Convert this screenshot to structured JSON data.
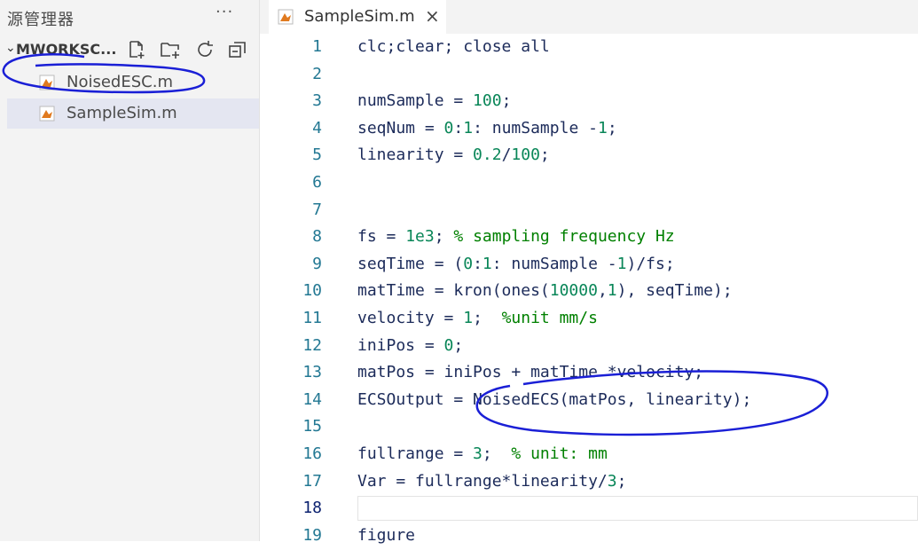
{
  "sidebar": {
    "title": "源管理器",
    "more": "···",
    "workspace": "MWORKSC...",
    "toolbar": [
      "new-file-icon",
      "new-folder-icon",
      "refresh-icon",
      "collapse-all-icon"
    ],
    "files": [
      {
        "label": "NoisedESC.m",
        "selected": false
      },
      {
        "label": "SampleSim.m",
        "selected": true
      }
    ]
  },
  "tab": {
    "label": "SampleSim.m",
    "close": "×"
  },
  "colors": {
    "keyword_blue": "#1c2b5a",
    "number_green": "#098658",
    "comment_green": "#008000",
    "line_number": "#237893",
    "annotation": "#1a1fd6",
    "matlab_orange": "#e07a1f"
  },
  "code": [
    {
      "n": "1",
      "parts": [
        {
          "t": "clc;clear; close all",
          "c": ""
        }
      ]
    },
    {
      "n": "2",
      "parts": []
    },
    {
      "n": "3",
      "parts": [
        {
          "t": "numSample = ",
          "c": ""
        },
        {
          "t": "100",
          "c": "num"
        },
        {
          "t": ";",
          "c": ""
        }
      ]
    },
    {
      "n": "4",
      "parts": [
        {
          "t": "seqNum = ",
          "c": ""
        },
        {
          "t": "0",
          "c": "num"
        },
        {
          "t": ":",
          "c": ""
        },
        {
          "t": "1",
          "c": "num"
        },
        {
          "t": ": numSample -",
          "c": ""
        },
        {
          "t": "1",
          "c": "num"
        },
        {
          "t": ";",
          "c": ""
        }
      ]
    },
    {
      "n": "5",
      "parts": [
        {
          "t": "linearity = ",
          "c": ""
        },
        {
          "t": "0.2",
          "c": "num"
        },
        {
          "t": "/",
          "c": ""
        },
        {
          "t": "100",
          "c": "num"
        },
        {
          "t": ";",
          "c": ""
        }
      ]
    },
    {
      "n": "6",
      "parts": []
    },
    {
      "n": "7",
      "parts": []
    },
    {
      "n": "8",
      "parts": [
        {
          "t": "fs = ",
          "c": ""
        },
        {
          "t": "1e3",
          "c": "num"
        },
        {
          "t": "; ",
          "c": ""
        },
        {
          "t": "% sampling frequency Hz",
          "c": "cm"
        }
      ]
    },
    {
      "n": "9",
      "parts": [
        {
          "t": "seqTime = (",
          "c": ""
        },
        {
          "t": "0",
          "c": "num"
        },
        {
          "t": ":",
          "c": ""
        },
        {
          "t": "1",
          "c": "num"
        },
        {
          "t": ": numSample -",
          "c": ""
        },
        {
          "t": "1",
          "c": "num"
        },
        {
          "t": ")/fs;",
          "c": ""
        }
      ]
    },
    {
      "n": "10",
      "parts": [
        {
          "t": "matTime = kron(ones(",
          "c": ""
        },
        {
          "t": "10000",
          "c": "num"
        },
        {
          "t": ",",
          "c": ""
        },
        {
          "t": "1",
          "c": "num"
        },
        {
          "t": "), seqTime);",
          "c": ""
        }
      ]
    },
    {
      "n": "11",
      "parts": [
        {
          "t": "velocity = ",
          "c": ""
        },
        {
          "t": "1",
          "c": "num"
        },
        {
          "t": ";  ",
          "c": ""
        },
        {
          "t": "%unit mm/s",
          "c": "cm"
        }
      ]
    },
    {
      "n": "12",
      "parts": [
        {
          "t": "iniPos = ",
          "c": ""
        },
        {
          "t": "0",
          "c": "num"
        },
        {
          "t": ";",
          "c": ""
        }
      ]
    },
    {
      "n": "13",
      "parts": [
        {
          "t": "matPos = iniPos + matTime *velocity;",
          "c": ""
        }
      ]
    },
    {
      "n": "14",
      "parts": [
        {
          "t": "ECSOutput = NoisedECS(matPos, linearity);",
          "c": ""
        }
      ]
    },
    {
      "n": "15",
      "parts": []
    },
    {
      "n": "16",
      "parts": [
        {
          "t": "fullrange = ",
          "c": ""
        },
        {
          "t": "3",
          "c": "num"
        },
        {
          "t": ";  ",
          "c": ""
        },
        {
          "t": "% unit: mm",
          "c": "cm"
        }
      ]
    },
    {
      "n": "17",
      "parts": [
        {
          "t": "Var = fullrange*linearity/",
          "c": ""
        },
        {
          "t": "3",
          "c": "num"
        },
        {
          "t": ";",
          "c": ""
        }
      ]
    },
    {
      "n": "18",
      "parts": [],
      "current": true
    },
    {
      "n": "19",
      "parts": [
        {
          "t": "figure",
          "c": ""
        }
      ]
    }
  ]
}
